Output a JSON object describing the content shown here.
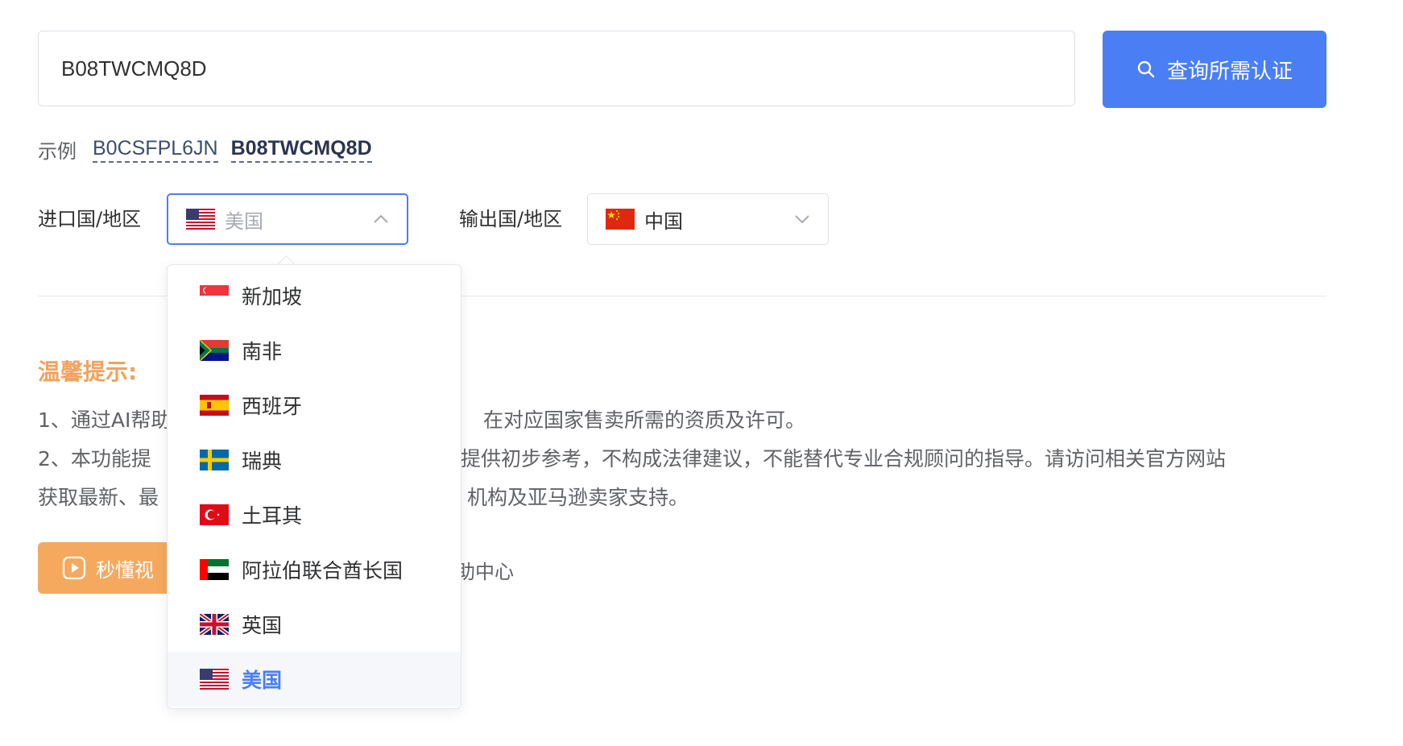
{
  "search": {
    "value": "B08TWCMQ8D",
    "button_label": "查询所需认证",
    "icon": "search-icon"
  },
  "examples": {
    "label": "示例",
    "items": [
      "B0CSFPL6JN",
      "B08TWCMQ8D"
    ]
  },
  "import_country": {
    "label": "进口国/地区",
    "selected": "美国",
    "flag": "us-flag",
    "state": "open"
  },
  "export_country": {
    "label": "输出国/地区",
    "selected": "中国",
    "flag": "cn-flag"
  },
  "dropdown": {
    "options": [
      {
        "label": "新加坡",
        "flag": "sg-flag"
      },
      {
        "label": "南非",
        "flag": "za-flag"
      },
      {
        "label": "西班牙",
        "flag": "es-flag"
      },
      {
        "label": "瑞典",
        "flag": "se-flag"
      },
      {
        "label": "土耳其",
        "flag": "tr-flag"
      },
      {
        "label": "阿拉伯联合酋长国",
        "flag": "ae-flag"
      },
      {
        "label": "英国",
        "flag": "gb-flag"
      },
      {
        "label": "美国",
        "flag": "us-flag",
        "selected": true
      }
    ]
  },
  "tips": {
    "title": "温馨提示:",
    "line1": "1、通过AI帮助",
    "line1_end": "在对应国家售卖所需的资质及许可。",
    "line2_start": "2、本功能提",
    "line2_end": "提供初步参考，不构成法律建议，不能替代专业合规顾问的指导。请访问相关官方网站",
    "line3_start": "获取最新、最",
    "line3_end": "机构及亚马逊卖家支持。"
  },
  "video_button": {
    "label": "秒懂视",
    "icon": "play-icon"
  },
  "help_link": "助中心",
  "colors": {
    "primary": "#4a7ef5",
    "warning": "#f0a35e",
    "video_button": "#f5a95f"
  }
}
